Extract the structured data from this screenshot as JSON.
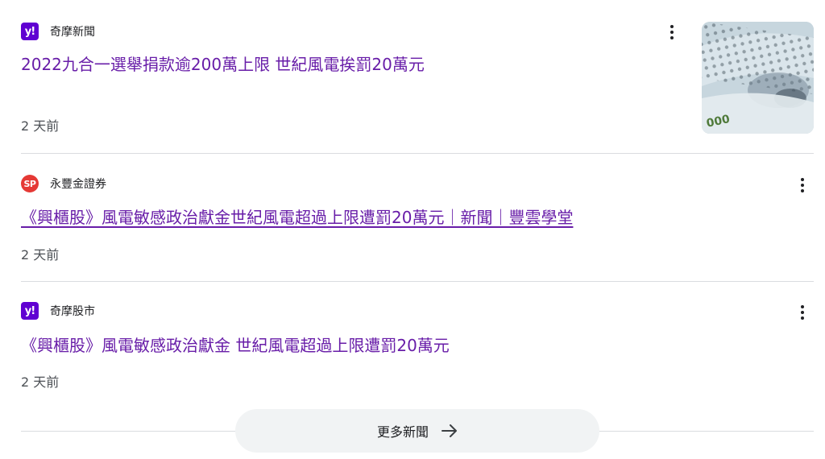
{
  "items": [
    {
      "source": "奇摩新聞",
      "logo": "yahoo-logo",
      "logo_text": "y!",
      "logo_color": "#6001d2",
      "headline": "2022九合一選舉捐款逾200萬上限 世紀風電挨罰20萬元",
      "time": "2 天前",
      "thumbnail": "banknote-thumbnail"
    },
    {
      "source": "永豐金證券",
      "logo": "sinopac-logo",
      "logo_text": "SP",
      "logo_color": "#e53935",
      "headline": "《興櫃股》風電敏感政治獻金世紀風電超過上限遭罰20萬元｜新聞｜豐雲學堂",
      "time": "2 天前"
    },
    {
      "source": "奇摩股市",
      "logo": "yahoo-logo",
      "logo_text": "y!",
      "logo_color": "#6001d2",
      "headline": "《興櫃股》風電敏感政治獻金 世紀風電超過上限遭罰20萬元",
      "time": "2 天前"
    }
  ],
  "more_news": {
    "label": "更多新聞",
    "icon": "arrow-right-icon"
  },
  "colors": {
    "headline": "#681da8",
    "divider": "#dadce0",
    "button_bg": "#f1f3f4"
  }
}
